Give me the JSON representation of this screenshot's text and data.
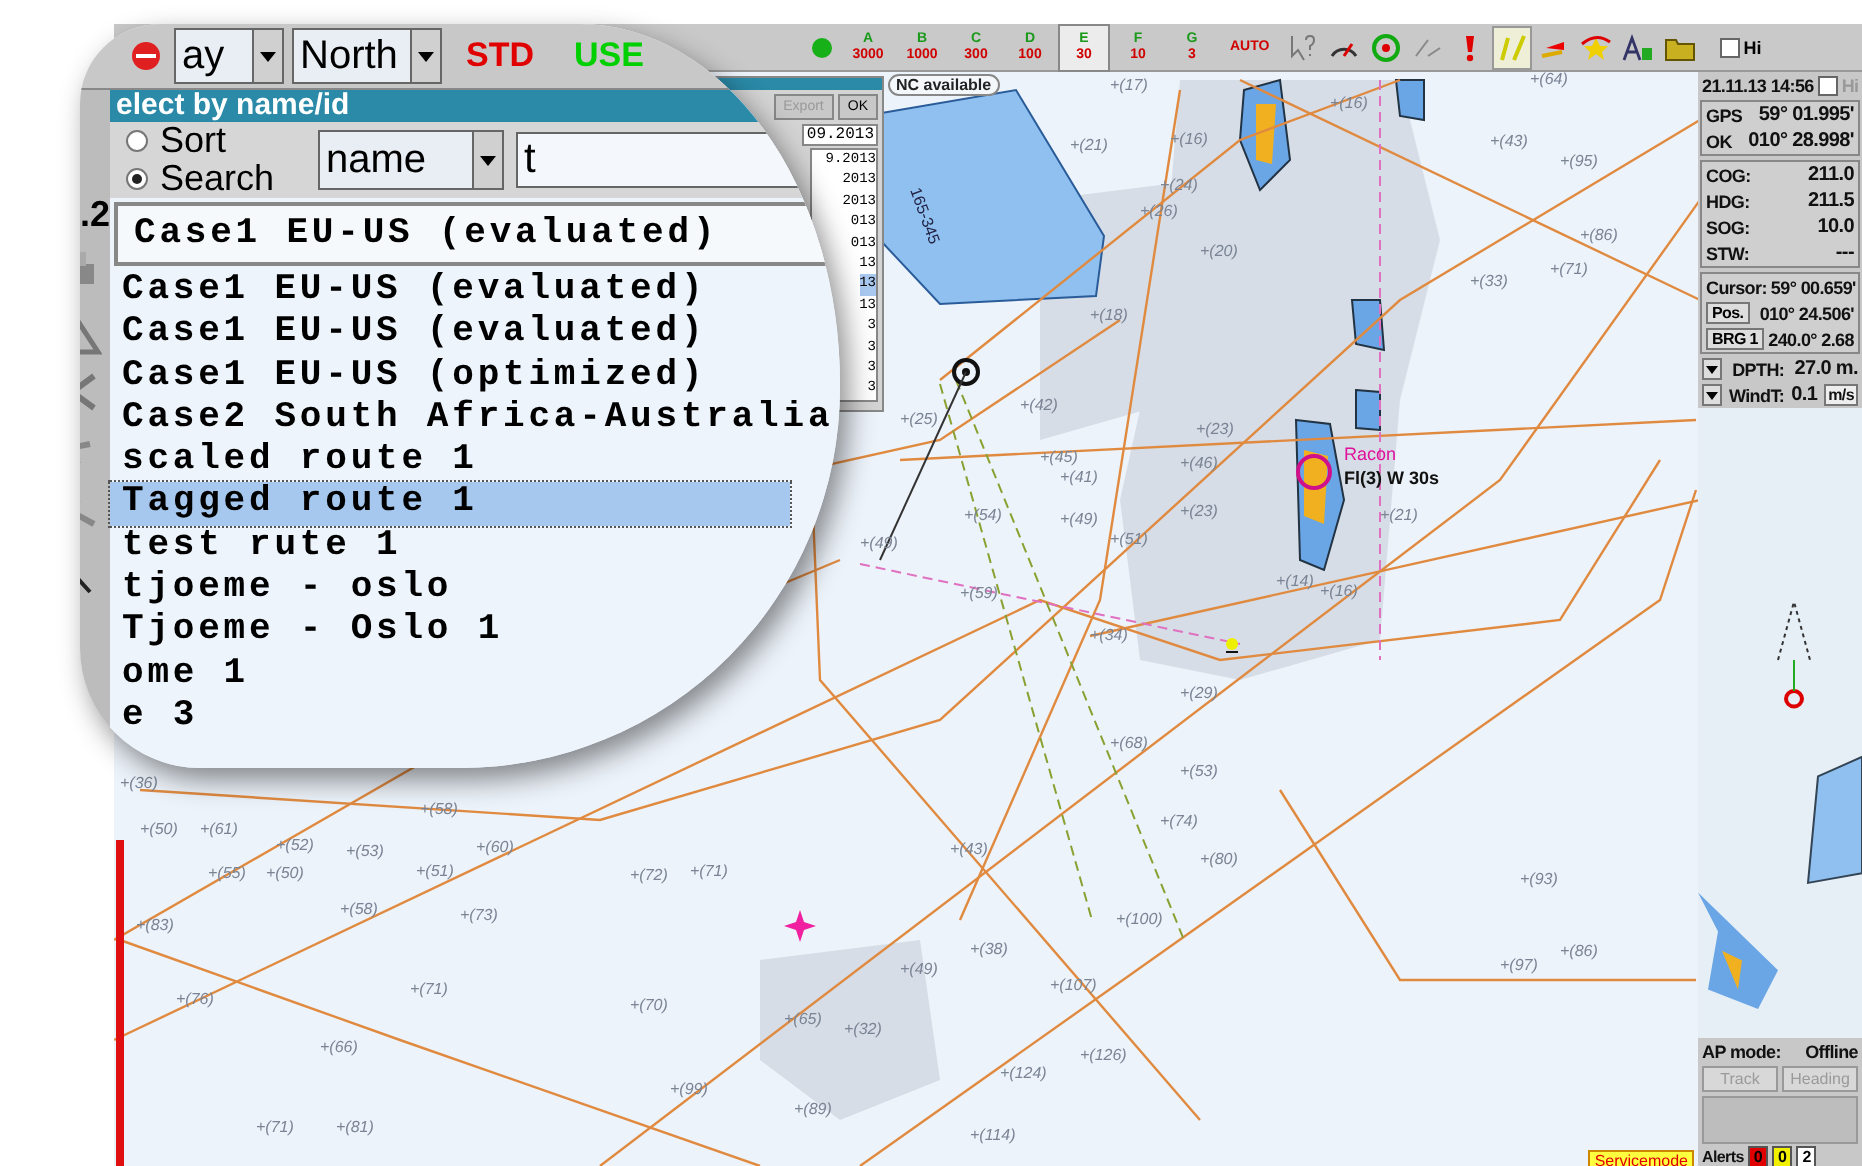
{
  "toolbar": {
    "day_mode": "ay",
    "orientation": "North",
    "display_mode": "STD",
    "user_mode": "USE",
    "scale_buttons": [
      {
        "letter": "A",
        "value": "3000",
        "selected": false
      },
      {
        "letter": "B",
        "value": "1000",
        "selected": false
      },
      {
        "letter": "C",
        "value": "300",
        "selected": false
      },
      {
        "letter": "D",
        "value": "100",
        "selected": false
      },
      {
        "letter": "E",
        "value": "30",
        "selected": true
      },
      {
        "letter": "F",
        "value": "10",
        "selected": false
      },
      {
        "letter": "G",
        "value": "3",
        "selected": false
      }
    ],
    "auto_label": "AUTO",
    "checkbox": {
      "label": "Hi",
      "checked": false
    }
  },
  "left_toolbar": {
    "label": ".2"
  },
  "route_dialog": {
    "title": "elect by name/id",
    "notice": "NC available",
    "buttons": [
      "Export",
      "OK"
    ],
    "date_select": "09.2013",
    "dates": [
      {
        "text": "9.2013",
        "selected": false
      },
      {
        "text": "2013",
        "selected": false
      },
      {
        "text": "2013",
        "selected": false
      },
      {
        "text": "013",
        "selected": false
      },
      {
        "text": "013",
        "selected": false
      },
      {
        "text": "13",
        "selected": false
      },
      {
        "text": "13",
        "selected": true
      },
      {
        "text": "13",
        "selected": false
      },
      {
        "text": "3",
        "selected": false
      },
      {
        "text": "3",
        "selected": false
      },
      {
        "text": "3",
        "selected": false
      },
      {
        "text": "3",
        "selected": false
      }
    ],
    "sort_options": [
      {
        "label": "Sort",
        "selected": false
      },
      {
        "label": "Search",
        "selected": true
      }
    ],
    "search_by": "name",
    "search_text": "t",
    "current_route": "Case1 EU-US (evaluated)",
    "routes": [
      {
        "name": "Case1 EU-US (evaluated)",
        "selected": false
      },
      {
        "name": "Case1 EU-US (evaluated)",
        "selected": false
      },
      {
        "name": "Case1 EU-US (optimized)",
        "selected": false
      },
      {
        "name": "Case2 South Africa-Australia",
        "selected": false
      },
      {
        "name": "scaled route 1",
        "selected": false
      },
      {
        "name": "Tagged route 1",
        "selected": true
      },
      {
        "name": "test rute 1",
        "selected": false
      },
      {
        "name": "tjoeme - oslo",
        "selected": false
      },
      {
        "name": "Tjoeme - Oslo 1",
        "selected": false
      },
      {
        "name": "ome 1",
        "selected": false
      },
      {
        "name": "e 3",
        "selected": false
      }
    ]
  },
  "chart": {
    "soundings": [
      "+(64)",
      "+(43)",
      "+(95)",
      "+(86)",
      "+(33)",
      "+(16)",
      "+(17)",
      "+(21)",
      "+(16)",
      "+(20)",
      "+(18)",
      "+(24)",
      "+(26)",
      "+(71)",
      "+(23)",
      "+(42)",
      "+(45)",
      "+(41)",
      "+(46)",
      "+(54)",
      "+(49)",
      "+(51)",
      "+(23)",
      "+(21)",
      "+(14)",
      "+(16)",
      "+(59)",
      "+(34)",
      "+(29)",
      "+(68)",
      "+(53)",
      "+(74)",
      "+(80)",
      "+(93)",
      "+(97)",
      "+(86)",
      "+(100)",
      "+(107)",
      "+(126)",
      "+(124)",
      "+(114)",
      "+(89)",
      "+(99)",
      "+(65)",
      "+(32)",
      "+(49)",
      "+(38)",
      "+(70)",
      "+(71)",
      "+(66)",
      "+(76)",
      "+(71)",
      "+(81)",
      "+(72)",
      "+(71)",
      "+(60)",
      "+(58)",
      "+(51)",
      "+(73)",
      "+(52)",
      "+(53)",
      "+(55)",
      "+(50)",
      "+(58)",
      "+(50)",
      "+(61)",
      "+(83)",
      "+(36)",
      "+(43)",
      "+(25)",
      "+(49)"
    ],
    "labels": [
      {
        "text": "Racon",
        "kind": "racon"
      },
      {
        "text": "Fl(3) W 30s",
        "kind": "light"
      },
      {
        "text": "165-345",
        "kind": "sector"
      }
    ],
    "status": "Servicemode"
  },
  "nav_panel": {
    "datetime": "21.11.13 14:56",
    "hide_checkbox": {
      "label": "Hi",
      "checked": false
    },
    "position": [
      {
        "label": "GPS",
        "value": "59° 01.995'"
      },
      {
        "label": "OK",
        "value": "010° 28.998'"
      }
    ],
    "motion": [
      {
        "label": "COG:",
        "value": "211.0"
      },
      {
        "label": "HDG:",
        "value": "211.5"
      },
      {
        "label": "SOG:",
        "value": "10.0"
      },
      {
        "label": "STW:",
        "value": "---"
      }
    ],
    "cursor": {
      "label": "Cursor:",
      "lat": "59° 00.659'",
      "pos_button": "Pos.",
      "lon": "010° 24.506'",
      "brg_button": "BRG 1",
      "bearing": "240.0°",
      "distance": "2.68"
    },
    "depth": {
      "label": "DPTH:",
      "value": "27.0 m."
    },
    "wind": {
      "label": "WindT:",
      "value": "0.1",
      "unit": "m/s"
    },
    "autopilot": {
      "label": "AP mode:",
      "value": "Offline",
      "buttons": [
        {
          "label": "Track",
          "disabled": true
        },
        {
          "label": "Heading",
          "disabled": true
        }
      ]
    },
    "alerts": {
      "label": "Alerts",
      "counts": [
        {
          "value": "0",
          "color": "#e00000"
        },
        {
          "value": "0",
          "color": "#f0f000"
        },
        {
          "value": "2",
          "color": "#ffffff"
        }
      ]
    }
  }
}
